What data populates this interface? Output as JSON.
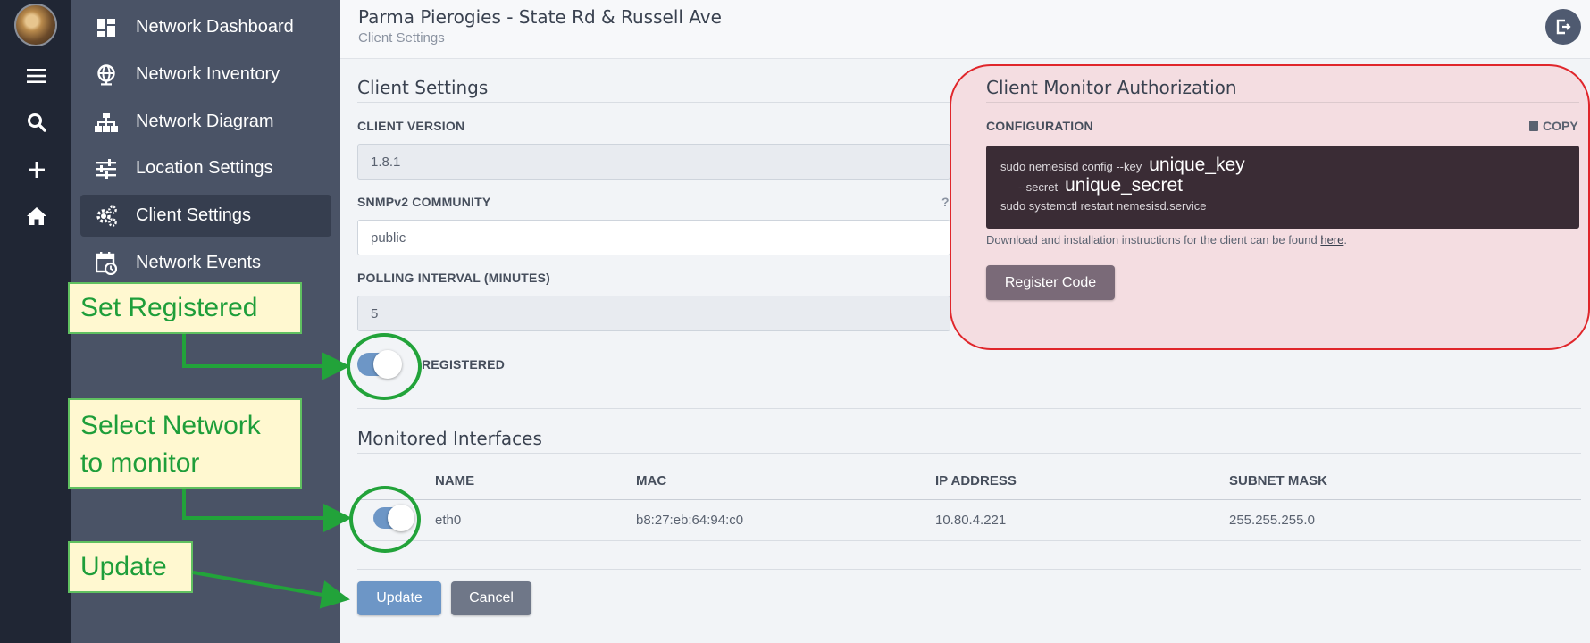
{
  "rail": {
    "icons": [
      "menu-icon",
      "search-icon",
      "plus-icon",
      "home-icon"
    ]
  },
  "nav": {
    "items": [
      {
        "label": "Network Dashboard",
        "icon": "dashboard-icon"
      },
      {
        "label": "Network Inventory",
        "icon": "globe-icon"
      },
      {
        "label": "Network Diagram",
        "icon": "sitemap-icon"
      },
      {
        "label": "Location Settings",
        "icon": "sliders-icon"
      },
      {
        "label": "Client Settings",
        "icon": "gears-icon",
        "active": true
      },
      {
        "label": "Network Events",
        "icon": "calendar-clock-icon"
      }
    ]
  },
  "header": {
    "title": "Parma Pierogies - State Rd & Russell Ave",
    "breadcrumb": "Client Settings"
  },
  "client_settings": {
    "title": "Client Settings",
    "version_label": "CLIENT VERSION",
    "version_value": "1.8.1",
    "snmp_label": "SNMPv2 COMMUNITY",
    "snmp_help": "?",
    "snmp_value": "public",
    "polling_label": "POLLING INTERVAL (MINUTES)",
    "polling_value": "5",
    "registered_label": "REGISTERED",
    "registered": true
  },
  "authorization": {
    "title": "Client Monitor Authorization",
    "config_label": "CONFIGURATION",
    "copy_label": "COPY",
    "line1_prefix": "sudo nemesisd config --key",
    "line1_value": "unique_key",
    "line2_prefix": "--secret",
    "line2_value": "unique_secret",
    "line3": "sudo systemctl restart nemesisd.service",
    "download_text": "Download and installation instructions for the client can be found ",
    "download_link": "here",
    "download_end": ".",
    "register_button": "Register Code"
  },
  "interfaces": {
    "title": "Monitored Interfaces",
    "columns": [
      "NAME",
      "MAC",
      "IP ADDRESS",
      "SUBNET MASK"
    ],
    "rows": [
      {
        "enabled": true,
        "name": "eth0",
        "mac": "b8:27:eb:64:94:c0",
        "ip": "10.80.4.221",
        "mask": "255.255.255.0"
      }
    ]
  },
  "actions": {
    "update": "Update",
    "cancel": "Cancel"
  },
  "annotations": {
    "set_registered": "Set Registered",
    "select_network_line1": "Select Network",
    "select_network_line2": "to monitor",
    "update": "Update"
  },
  "colors": {
    "primary_button": "#6d96c6",
    "secondary_button": "#6f7788",
    "register_button": "#7a6a78",
    "annotation_green": "#22a33a",
    "highlight_border": "#e0262b"
  }
}
